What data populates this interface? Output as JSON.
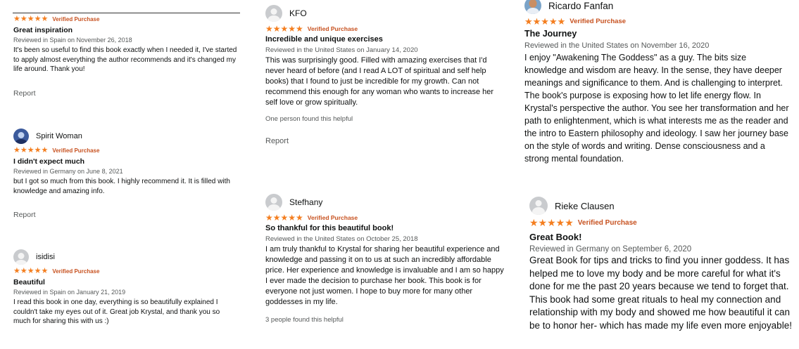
{
  "reviews": [
    {
      "reviewer": "",
      "stars": "★★★★★",
      "verified": "Verified Purchase",
      "title": "Great inspiration",
      "meta": "Reviewed in Spain on November 26, 2018",
      "body": "It's been so useful to find this book exactly when I needed it, I've started to apply almost everything the author recommends and it's changed my life around. Thank you!",
      "report": "Report"
    },
    {
      "reviewer": "Spirit Woman",
      "stars": "★★★★★",
      "verified": "Verified Purchase",
      "title": "I didn't expect much",
      "meta": "Reviewed in Germany on June 8, 2021",
      "body": "but I got so much from this book. I highly recommend it. It is filled with knowledge and amazing info.",
      "report": "Report"
    },
    {
      "reviewer": "isidisi",
      "stars": "★★★★★",
      "verified": "Verified Purchase",
      "title": "Beautiful",
      "meta": "Reviewed in Spain on January 21, 2019",
      "body": "I read this book in one day, everything is so beautifully explained I couldn't take my eyes out of it. Great job Krystal, and thank you so much for sharing this with us :)"
    },
    {
      "reviewer": "KFO",
      "stars": "★★★★★",
      "verified": "Verified Purchase",
      "title": "Incredible and unique exercises",
      "meta": "Reviewed in the United States on January 14, 2020",
      "body": "This was surprisingly good. Filled with amazing exercises that I'd never heard of before (and I read A LOT of spiritual and self help books) that I found to just be incredible for my growth. Can not recommend this enough for any woman who wants to increase her self love or grow spiritually.",
      "helpful": "One person found this helpful",
      "report": "Report"
    },
    {
      "reviewer": "Stefhany",
      "stars": "★★★★★",
      "verified": "Verified Purchase",
      "title": "So thankful for this beautiful book!",
      "meta": "Reviewed in the United States on October 25, 2018",
      "body": "I am truly thankful to Krystal for sharing her beautiful experience and knowledge and passing it on to us at such an incredibly affordable price. Her experience and knowledge is invaluable and I am so happy I ever made the decision to purchase her book. This book is for everyone not just women. I hope to buy more for many other goddesses in my life.",
      "helpful": "3 people found this helpful"
    },
    {
      "reviewer": "Ricardo Fanfan",
      "stars": "★★★★★",
      "verified": "Verified Purchase",
      "title": "The Journey",
      "meta": "Reviewed in the United States on November 16, 2020",
      "body": "I enjoy \"Awakening The Goddess\" as a guy. The bits size knowledge and wisdom are heavy. In the sense, they have deeper meanings and significance to them. And is challenging to interpret. The book's purpose is exposing how to let life energy flow. In Krystal's perspective the author. You see her transformation and her path to enlightenment, which is what interests me as the reader and the intro to Eastern philosophy and ideology. I saw her journey base on the style of words and writing. Dense consciousness and a strong mental foundation."
    },
    {
      "reviewer": "Rieke Clausen",
      "stars": "★★★★★",
      "verified": "Verified Purchase",
      "title": "Great Book!",
      "meta": "Reviewed in Germany on September 6, 2020",
      "body": "Great Book for tips and tricks to find you inner goddess. It has helped me to love my body and be more careful for what it's done for me the past 20 years because we tend to forget that. This book had some great rituals to heal my connection and relationship with my body and showed me how beautiful it can be to honor her- which has made my life even more enjoyable!"
    }
  ]
}
